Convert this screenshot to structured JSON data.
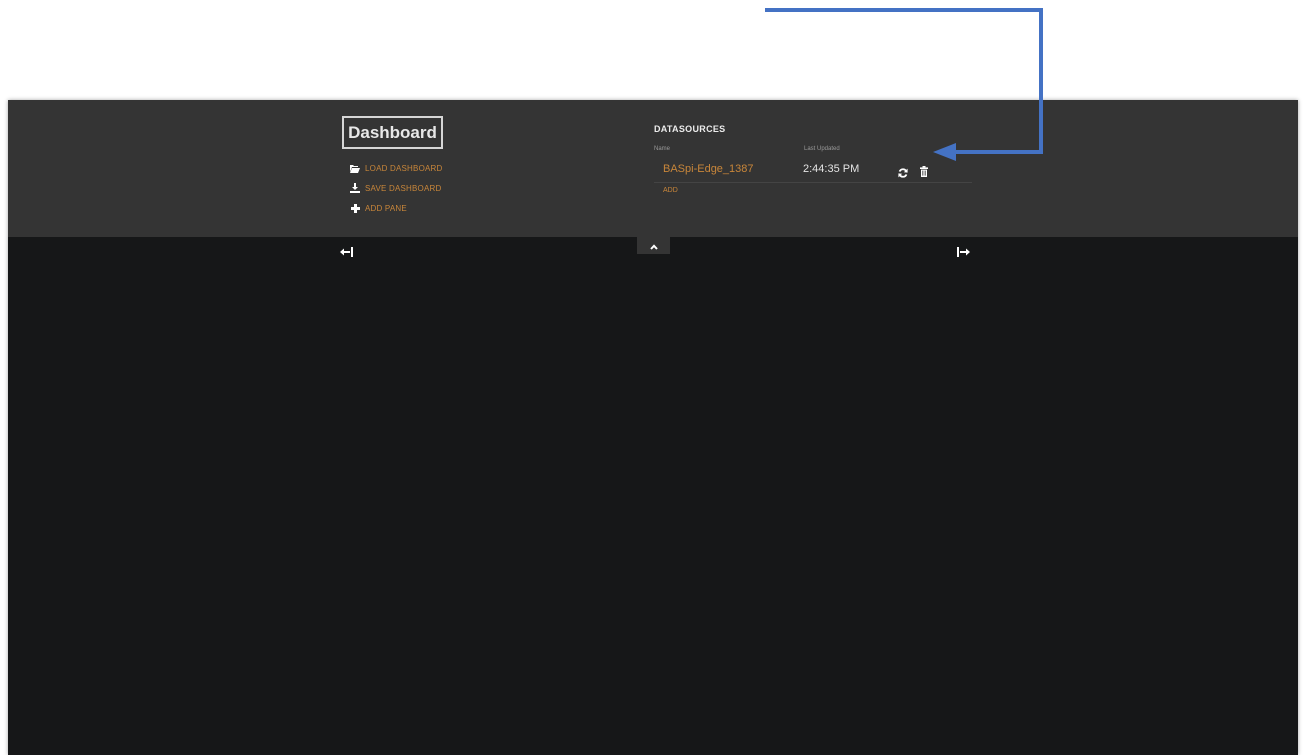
{
  "header": {
    "title": "Dashboard",
    "menu": [
      {
        "label": "LOAD DASHBOARD",
        "icon": "folder-open-icon"
      },
      {
        "label": "SAVE DASHBOARD",
        "icon": "download-icon"
      },
      {
        "label": "ADD PANE",
        "icon": "plus-icon"
      }
    ]
  },
  "datasources": {
    "title": "DATASOURCES",
    "col_name": "Name",
    "col_updated": "Last Updated",
    "rows": [
      {
        "name": "BASpi-Edge_1387",
        "last_updated": "2:44:35 PM"
      }
    ],
    "add_label": "ADD"
  },
  "colors": {
    "accent": "#c8863a",
    "header_bg": "#343434",
    "board_bg": "#161718",
    "annotation_arrow": "#4472c4"
  },
  "icons": {
    "refresh": "refresh-icon",
    "delete": "trash-icon",
    "toggle_header": "chevron-up-icon",
    "shrink_columns": "arrow-left-bar-icon",
    "grow_columns": "arrow-right-bar-icon"
  }
}
